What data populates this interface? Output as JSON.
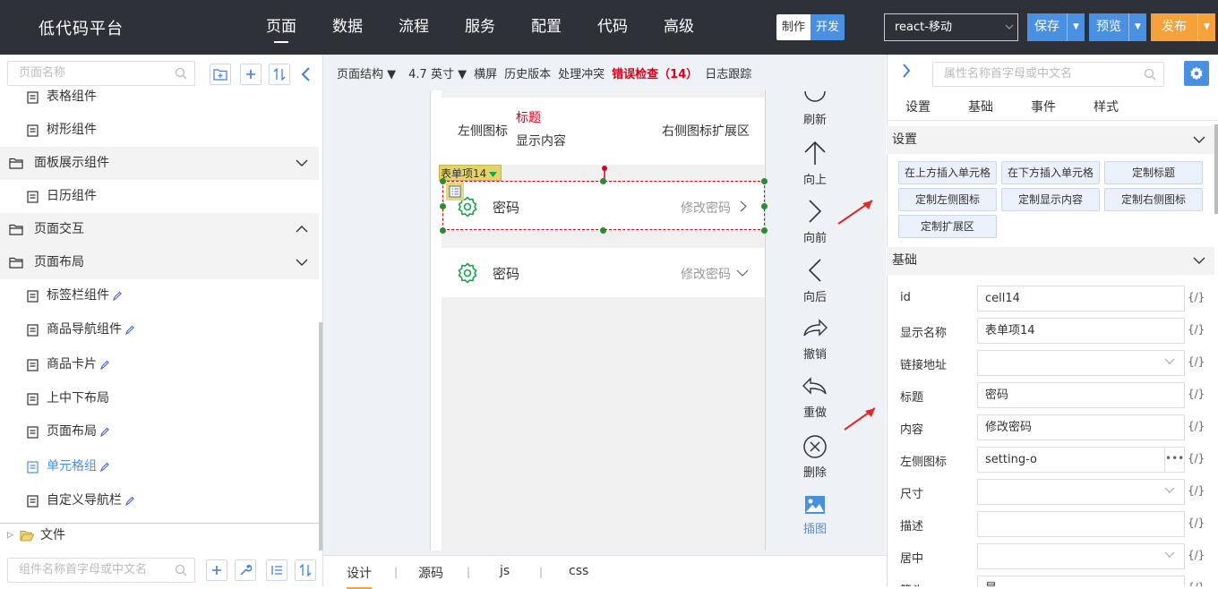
{
  "app": {
    "title": "低代码平台"
  },
  "nav": {
    "items": [
      "页面",
      "数据",
      "流程",
      "服务",
      "配置",
      "代码",
      "高级"
    ]
  },
  "mode": {
    "make": "制作",
    "dev": "开发"
  },
  "platform": {
    "selected": "react-移动"
  },
  "actions": {
    "save": "保存",
    "preview": "预览",
    "publish": "发布"
  },
  "left": {
    "search_placeholder": "页面名称",
    "tree": [
      {
        "label": "表格组件",
        "type": "page"
      },
      {
        "label": "树形组件",
        "type": "page"
      },
      {
        "label": "面板展示组件",
        "type": "folder"
      },
      {
        "label": "日历组件",
        "type": "page"
      },
      {
        "label": "页面交互",
        "type": "folder"
      },
      {
        "label": "页面布局",
        "type": "folder"
      },
      {
        "label": "标签栏组件",
        "type": "page"
      },
      {
        "label": "商品导航组件",
        "type": "page"
      },
      {
        "label": "商品卡片",
        "type": "page"
      },
      {
        "label": "上中下布局",
        "type": "page"
      },
      {
        "label": "页面布局",
        "type": "page"
      },
      {
        "label": "单元格组",
        "type": "page",
        "selected": true
      },
      {
        "label": "自定义导航栏",
        "type": "page"
      },
      {
        "label": "文件",
        "type": "folder"
      }
    ],
    "component_search_placeholder": "组件名称首字母或中文名"
  },
  "toolbar": {
    "structure": "页面结构",
    "size": "4.7 英寸",
    "landscape": "横屏",
    "history": "历史版本",
    "conflict": "处理冲突",
    "error_check": "错误检查（14）",
    "log": "日志跟踪"
  },
  "canvas": {
    "cell_top": {
      "left": "左侧图标",
      "title": "标题",
      "content": "显示内容",
      "right": "右侧图标扩展区"
    },
    "selection_tag": "表单项14",
    "cells": [
      {
        "title": "密码",
        "value": "修改密码",
        "arrow": "right"
      },
      {
        "title": "密码",
        "value": "修改密码",
        "arrow": "down"
      }
    ]
  },
  "tools": {
    "refresh": "刷新",
    "up": "向上",
    "forward": "向前",
    "back": "向后",
    "undo": "撤销",
    "redo": "重做",
    "delete": "删除",
    "insert_image": "插图"
  },
  "bottom_tabs": [
    "设计",
    "源码",
    "js",
    "css"
  ],
  "right": {
    "search_placeholder": "属性名称首字母或中文名",
    "tabs": [
      "设置",
      "基础",
      "事件",
      "样式"
    ],
    "settings_title": "设置",
    "settings_buttons": [
      "在上方插入单元格",
      "在下方插入单元格",
      "定制标题",
      "定制左侧图标",
      "定制显示内容",
      "定制右侧图标",
      "定制扩展区"
    ],
    "basic_title": "基础",
    "props": [
      {
        "label": "id",
        "value": "cell14",
        "kind": "text"
      },
      {
        "label": "显示名称",
        "value": "表单项14",
        "kind": "text"
      },
      {
        "label": "链接地址",
        "value": "",
        "kind": "select"
      },
      {
        "label": "标题",
        "value": "密码",
        "kind": "text"
      },
      {
        "label": "内容",
        "value": "修改密码",
        "kind": "text"
      },
      {
        "label": "左侧图标",
        "value": "setting-o",
        "kind": "picker"
      },
      {
        "label": "尺寸",
        "value": "",
        "kind": "select"
      },
      {
        "label": "描述",
        "value": "",
        "kind": "text"
      },
      {
        "label": "居中",
        "value": "",
        "kind": "select"
      },
      {
        "label": "箭头",
        "value": "是",
        "kind": "select"
      }
    ],
    "fx": "{/}"
  }
}
